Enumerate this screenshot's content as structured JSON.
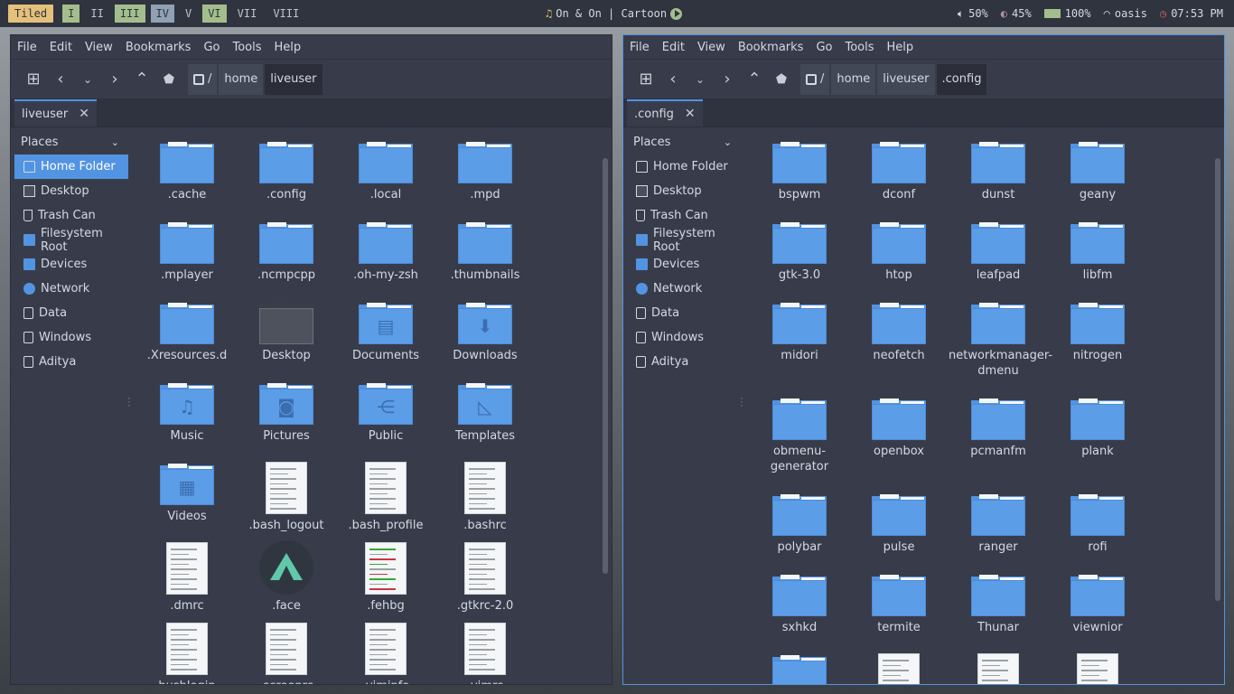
{
  "topbar": {
    "layout": "Tiled",
    "workspaces": [
      "I",
      "II",
      "III",
      "IV",
      "V",
      "VI",
      "VII",
      "VIII"
    ],
    "now_playing": "On & On | Cartoon",
    "volume": "50%",
    "brightness": "45%",
    "battery": "100%",
    "wifi": "oasis",
    "clock": "07:53 PM"
  },
  "menu": [
    "File",
    "Edit",
    "View",
    "Bookmarks",
    "Go",
    "Tools",
    "Help"
  ],
  "places_label": "Places",
  "places": [
    "Home Folder",
    "Desktop",
    "Trash Can",
    "Filesystem Root",
    "Devices",
    "Network",
    "Data",
    "Windows",
    "Aditya"
  ],
  "left": {
    "crumbs": [
      "/",
      "home",
      "liveuser"
    ],
    "tab": "liveuser",
    "items": [
      ".cache",
      ".config",
      ".local",
      ".mpd",
      ".mplayer",
      ".ncmpcpp",
      ".oh-my-zsh",
      ".thumbnails",
      ".Xresources.d",
      "Desktop",
      "Documents",
      "Downloads",
      "Music",
      "Pictures",
      "Public",
      "Templates",
      "Videos",
      ".bash_logout",
      ".bash_profile",
      ".bashrc",
      ".dmrc",
      ".face",
      ".fehbg",
      ".gtkrc-2.0",
      "hushlogin",
      ".screenrc",
      ".viminfo",
      ".vimrc"
    ]
  },
  "right": {
    "crumbs": [
      "/",
      "home",
      "liveuser",
      ".config"
    ],
    "tab": ".config",
    "items": [
      "bspwm",
      "dconf",
      "dunst",
      "geany",
      "gtk-3.0",
      "htop",
      "leafpad",
      "libfm",
      "midori",
      "neofetch",
      "networkmanager-dmenu",
      "nitrogen",
      "obmenu-generator",
      "openbox",
      "pcmanfm",
      "plank",
      "polybar",
      "pulse",
      "ranger",
      "rofi",
      "sxhkd",
      "termite",
      "Thunar",
      "viewnior"
    ]
  }
}
